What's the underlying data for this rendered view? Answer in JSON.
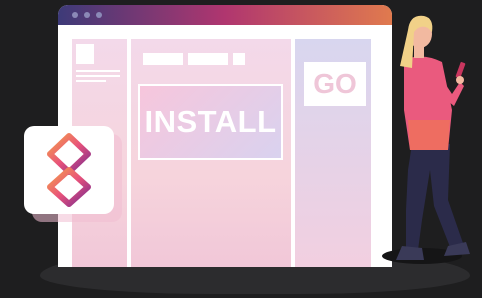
{
  "hero": {
    "install_label": "INSTALL",
    "go_label": "GO"
  },
  "colors": {
    "background": "#1e1e1f",
    "titlebar_start": "#3d3a78",
    "titlebar_mid": "#b0366f",
    "titlebar_end": "#e07a4e",
    "logo_gradient_start": "#e8527a",
    "logo_gradient_end": "#7a2b8f",
    "person_top": "#ea5a7e",
    "person_pants": "#2b2b4a",
    "person_hair": "#f1d188"
  },
  "icons": {
    "logo": "app-logo-icon",
    "window_dots": "window-dot-icon"
  }
}
